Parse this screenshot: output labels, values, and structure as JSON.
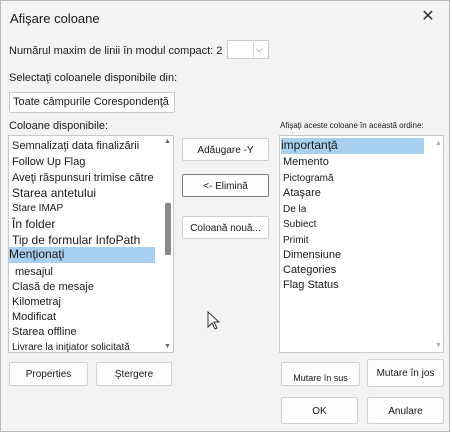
{
  "dialog": {
    "title": "Afişare coloane",
    "close_glyph": "✕"
  },
  "compact": {
    "label": "Numărul maxim de linii în modul compact: 2",
    "dropdown_glyph": "⌵"
  },
  "source": {
    "label": "Selectaţi coloanele disponibile din:",
    "selected": "Toate câmpurile Corespondenţă"
  },
  "available": {
    "label": "Coloane disponibile:",
    "items": [
      "Semnalizaţi data finalizării",
      "Follow Up Flag",
      "Aveţi răspunsuri trimise către",
      "Starea antetului",
      "Stare IMAP",
      "În folder",
      "Tip de formular InfoPath",
      "Menţionaţi",
      "mesajul",
      "Clasă de mesaje",
      "Kilometraj",
      "Modificat",
      "Starea offline",
      "Livrare la iniţiator solicitată"
    ]
  },
  "shown": {
    "label": "Afişaţi aceste coloane în această ordine:",
    "items": [
      "importanţă",
      "Memento",
      "Pictogramă",
      "Ataşare",
      "De la",
      "Subiect",
      "Primit",
      "Dimensiune",
      "Categories",
      "Flag Status"
    ]
  },
  "buttons": {
    "add": "Adăugare -Y",
    "remove": "<- Elimină",
    "new_column": "Coloană nouă...",
    "properties": "Properties",
    "delete": "Ştergere",
    "move_up": "Mutare în sus",
    "move_down": "Mutare în jos",
    "ok": "OK",
    "cancel": "Anulare"
  },
  "colors": {
    "selection": "#a8d0f0",
    "dialog_bg": "#f3f3f3"
  }
}
